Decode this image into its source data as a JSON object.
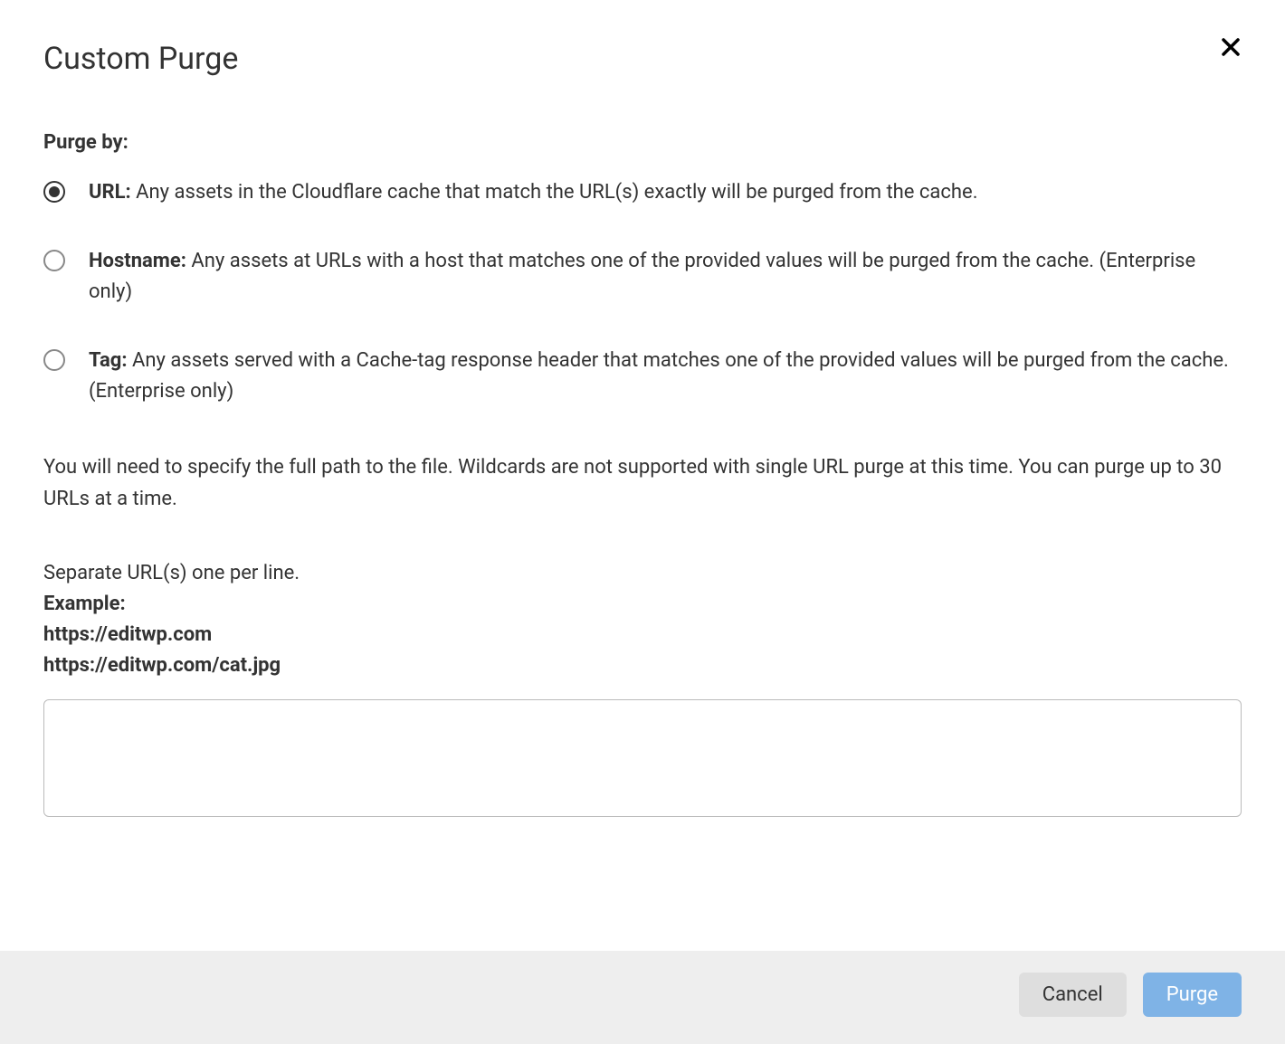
{
  "dialog": {
    "title": "Custom Purge",
    "section_label": "Purge by:",
    "options": [
      {
        "name": "URL:",
        "description": " Any assets in the Cloudflare cache that match the URL(s) exactly will be purged from the cache.",
        "checked": true
      },
      {
        "name": "Hostname:",
        "description": " Any assets at URLs with a host that matches one of the provided values will be purged from the cache. (Enterprise only)",
        "checked": false
      },
      {
        "name": "Tag:",
        "description": " Any assets served with a Cache-tag response header that matches one of the provided values will be purged from the cache. (Enterprise only)",
        "checked": false
      }
    ],
    "help_text": "You will need to specify the full path to the file. Wildcards are not supported with single URL purge at this time. You can purge up to 30 URLs at a time.",
    "instructions": {
      "line1": "Separate URL(s) one per line.",
      "example_label": "Example:",
      "example_line1": "https://editwp.com",
      "example_line2": "https://editwp.com/cat.jpg"
    },
    "textarea_value": "",
    "footer": {
      "cancel_label": "Cancel",
      "purge_label": "Purge"
    }
  }
}
